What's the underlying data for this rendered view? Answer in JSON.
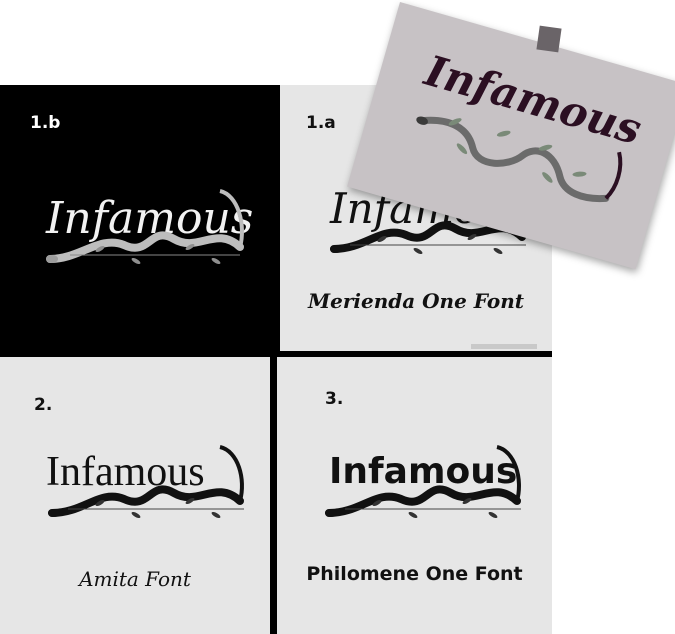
{
  "panels": {
    "p1b": {
      "number": "1.b",
      "logo_text": "Infamous",
      "caption": ""
    },
    "p1a": {
      "number": "1.a",
      "logo_text": "Infamous",
      "caption": "Merienda One Font"
    },
    "p2": {
      "number": "2.",
      "logo_text": "Infamous",
      "caption": "Amita Font"
    },
    "p3": {
      "number": "3.",
      "logo_text": "Infamous",
      "caption": "Philomene One Font"
    }
  },
  "photo": {
    "logo_text": "Infamous"
  },
  "colors": {
    "dark_panel": "#000000",
    "light_panel": "#e6e6e6",
    "ink": "#111111",
    "photo_paper": "#c7c2c5",
    "photo_ink": "#2b0f22"
  },
  "icons": [
    "snake-icon",
    "leaf-branch-icon"
  ]
}
